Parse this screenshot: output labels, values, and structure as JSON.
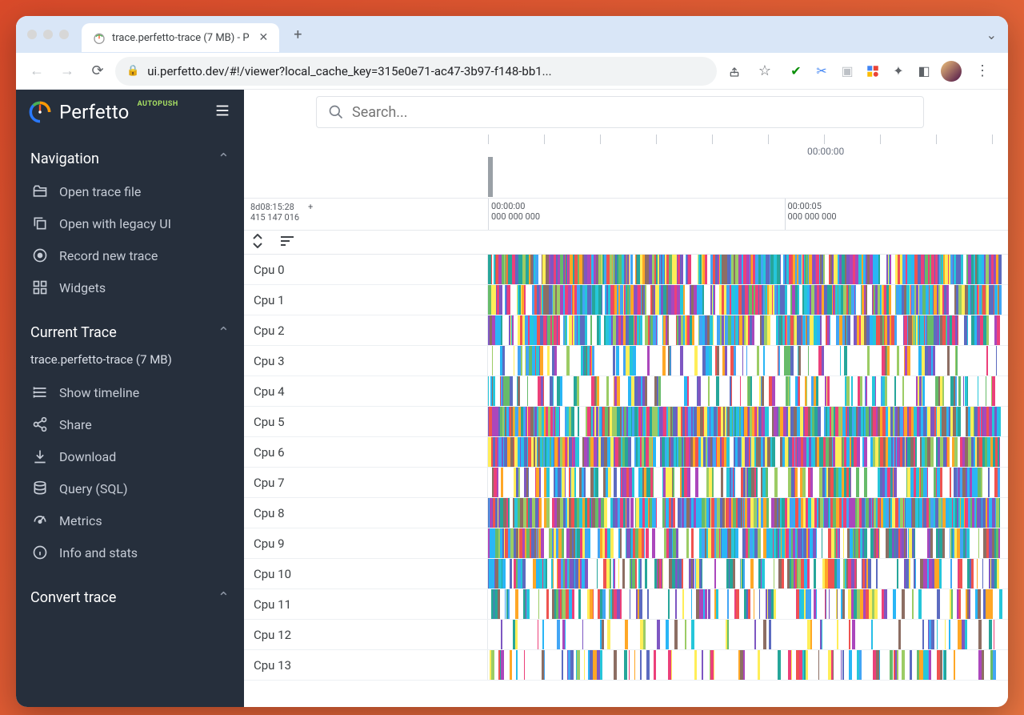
{
  "browser": {
    "tab_title": "trace.perfetto-trace (7 MB) - P",
    "url": "ui.perfetto.dev/#!/viewer?local_cache_key=315e0e71-ac47-3b97-f148-bb1..."
  },
  "brand": {
    "name": "Perfetto",
    "tag": "AUTOPUSH"
  },
  "search": {
    "placeholder": "Search..."
  },
  "sidebar": {
    "sections": [
      {
        "title": "Navigation",
        "items": [
          {
            "icon": "folder-open",
            "label": "Open trace file"
          },
          {
            "icon": "copy",
            "label": "Open with legacy UI"
          },
          {
            "icon": "record",
            "label": "Record new trace"
          },
          {
            "icon": "widgets",
            "label": "Widgets"
          }
        ]
      },
      {
        "title": "Current Trace",
        "trace_name": "trace.perfetto-trace (7 MB)",
        "items": [
          {
            "icon": "timeline",
            "label": "Show timeline"
          },
          {
            "icon": "share",
            "label": "Share"
          },
          {
            "icon": "download",
            "label": "Download"
          },
          {
            "icon": "database",
            "label": "Query (SQL)"
          },
          {
            "icon": "speed",
            "label": "Metrics"
          },
          {
            "icon": "info",
            "label": "Info and stats"
          }
        ]
      },
      {
        "title": "Convert trace",
        "items": []
      }
    ]
  },
  "timeline": {
    "overview_ticks": [
      {
        "pos": 42,
        "label": "00:00:00"
      },
      {
        "pos": 80,
        "label": "00:00:05"
      }
    ],
    "origin": {
      "top": "8d08:15:28",
      "bottom": "415 147 016"
    },
    "marks": [
      {
        "pos": 0,
        "top": "00:00:00",
        "bottom": "000 000 000"
      },
      {
        "pos": 57,
        "top": "00:00:05",
        "bottom": "000 000 000"
      }
    ]
  },
  "tracks": [
    {
      "label": "Cpu 0",
      "density": 0.95
    },
    {
      "label": "Cpu 1",
      "density": 0.93
    },
    {
      "label": "Cpu 2",
      "density": 0.9
    },
    {
      "label": "Cpu 3",
      "density": 0.45
    },
    {
      "label": "Cpu 4",
      "density": 0.6
    },
    {
      "label": "Cpu 5",
      "density": 0.97
    },
    {
      "label": "Cpu 6",
      "density": 0.92
    },
    {
      "label": "Cpu 7",
      "density": 0.7
    },
    {
      "label": "Cpu 8",
      "density": 0.96
    },
    {
      "label": "Cpu 9",
      "density": 0.88
    },
    {
      "label": "Cpu 10",
      "density": 0.78
    },
    {
      "label": "Cpu 11",
      "density": 0.65
    },
    {
      "label": "Cpu 12",
      "density": 0.3
    },
    {
      "label": "Cpu 13",
      "density": 0.55
    }
  ],
  "colors": [
    "#7e57c2",
    "#5c6bc0",
    "#26a69a",
    "#ffa726",
    "#ec407a",
    "#ab47bc",
    "#66bb6a",
    "#42a5f5",
    "#ffee58",
    "#ef5350",
    "#29b6f6",
    "#9ccc65",
    "#8d6e63",
    "#26c6da"
  ]
}
